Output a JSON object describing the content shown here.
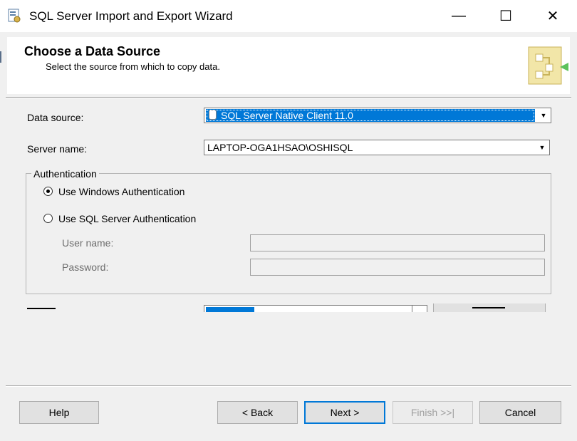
{
  "window": {
    "title": "SQL Server Import and Export Wizard",
    "minimize_glyph": "—",
    "maximize_glyph": "☐",
    "close_glyph": "✕"
  },
  "header": {
    "title": "Choose a Data Source",
    "subtitle": "Select the source from which to copy data."
  },
  "form": {
    "data_source": {
      "label": "Data source:",
      "value": "SQL Server Native Client 11.0"
    },
    "server_name": {
      "label": "Server name:",
      "value": "LAPTOP-OGA1HSAO\\OSHISQL"
    },
    "authentication": {
      "group_label": "Authentication",
      "windows_auth_label": "Use Windows Authentication",
      "sql_auth_label": "Use SQL Server Authentication",
      "selected": "windows",
      "username_label": "User name:",
      "username_value": "",
      "password_label": "Password:",
      "password_value": ""
    }
  },
  "buttons": {
    "help": "Help",
    "back": "< Back",
    "next": "Next >",
    "finish": "Finish >>|",
    "cancel": "Cancel"
  },
  "colors": {
    "selection": "#0078d7",
    "dialog_bg": "#f0f0f0"
  }
}
